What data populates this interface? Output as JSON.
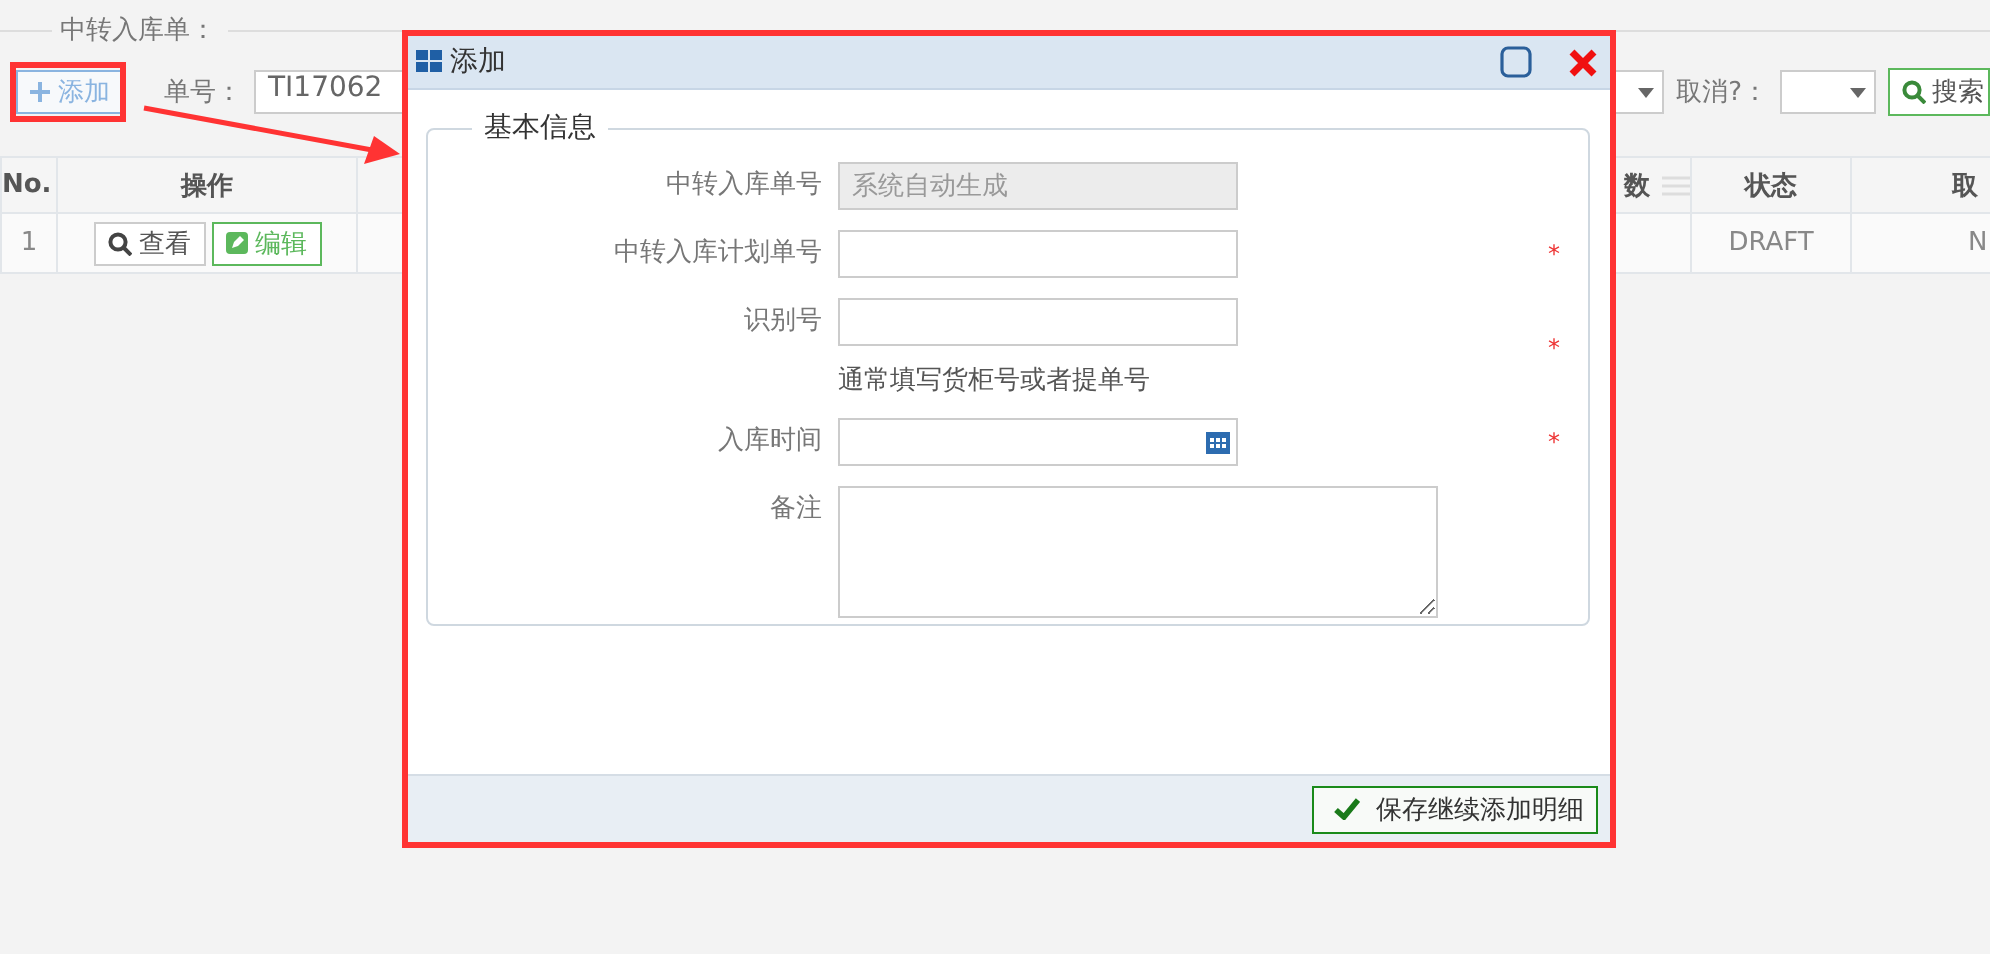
{
  "page": {
    "legend": "中转入库单：",
    "add_button": "添加",
    "number_filter": {
      "label": "单号：",
      "value": "TI17062"
    },
    "cancel_filter": {
      "label": "取消?："
    },
    "search_button": "搜索"
  },
  "table": {
    "columns": [
      {
        "header": "No."
      },
      {
        "header": "操作"
      },
      {
        "header": "数"
      },
      {
        "header": "状态"
      },
      {
        "header": "取"
      }
    ],
    "rows": [
      {
        "no": "1",
        "actions": [
          {
            "label": "查看",
            "kind": "view"
          },
          {
            "label": "编辑",
            "kind": "edit"
          }
        ],
        "status": "DRAFT",
        "cancelled": "N"
      }
    ]
  },
  "dialog": {
    "title": "添加",
    "fieldset": "基本信息",
    "fields": [
      {
        "label": "中转入库单号",
        "kind": "text",
        "value": "系统自动生成",
        "disabled": true,
        "required": false
      },
      {
        "label": "中转入库计划单号",
        "kind": "text",
        "disabled": false,
        "required": true,
        "required_mark": "*"
      },
      {
        "label": "识别号",
        "kind": "text",
        "disabled": false,
        "required": true,
        "required_mark": "*",
        "hint": "通常填写货柜号或者提单号"
      },
      {
        "label": "入库时间",
        "kind": "date",
        "disabled": false,
        "required": true,
        "required_mark": "*"
      },
      {
        "label": "备注",
        "kind": "textarea",
        "disabled": false,
        "required": false
      }
    ],
    "save_button": "保存继续添加明细"
  }
}
